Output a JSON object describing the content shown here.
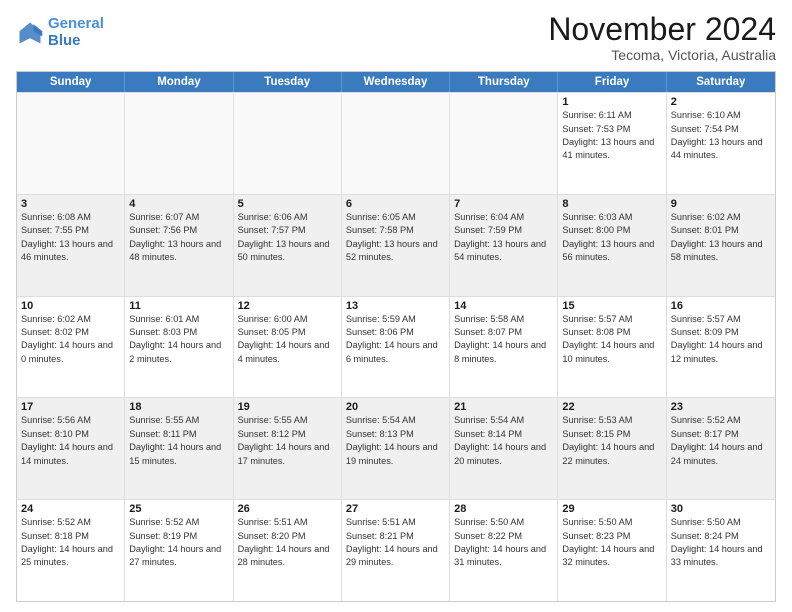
{
  "header": {
    "logo_line1": "General",
    "logo_line2": "Blue",
    "title": "November 2024",
    "subtitle": "Tecoma, Victoria, Australia"
  },
  "calendar": {
    "weekdays": [
      "Sunday",
      "Monday",
      "Tuesday",
      "Wednesday",
      "Thursday",
      "Friday",
      "Saturday"
    ],
    "weeks": [
      [
        {
          "day": "",
          "empty": true
        },
        {
          "day": "",
          "empty": true
        },
        {
          "day": "",
          "empty": true
        },
        {
          "day": "",
          "empty": true
        },
        {
          "day": "",
          "empty": true
        },
        {
          "day": "1",
          "sunrise": "6:11 AM",
          "sunset": "7:53 PM",
          "daylight": "13 hours and 41 minutes."
        },
        {
          "day": "2",
          "sunrise": "6:10 AM",
          "sunset": "7:54 PM",
          "daylight": "13 hours and 44 minutes."
        }
      ],
      [
        {
          "day": "3",
          "sunrise": "6:08 AM",
          "sunset": "7:55 PM",
          "daylight": "13 hours and 46 minutes."
        },
        {
          "day": "4",
          "sunrise": "6:07 AM",
          "sunset": "7:56 PM",
          "daylight": "13 hours and 48 minutes."
        },
        {
          "day": "5",
          "sunrise": "6:06 AM",
          "sunset": "7:57 PM",
          "daylight": "13 hours and 50 minutes."
        },
        {
          "day": "6",
          "sunrise": "6:05 AM",
          "sunset": "7:58 PM",
          "daylight": "13 hours and 52 minutes."
        },
        {
          "day": "7",
          "sunrise": "6:04 AM",
          "sunset": "7:59 PM",
          "daylight": "13 hours and 54 minutes."
        },
        {
          "day": "8",
          "sunrise": "6:03 AM",
          "sunset": "8:00 PM",
          "daylight": "13 hours and 56 minutes."
        },
        {
          "day": "9",
          "sunrise": "6:02 AM",
          "sunset": "8:01 PM",
          "daylight": "13 hours and 58 minutes."
        }
      ],
      [
        {
          "day": "10",
          "sunrise": "6:02 AM",
          "sunset": "8:02 PM",
          "daylight": "14 hours and 0 minutes."
        },
        {
          "day": "11",
          "sunrise": "6:01 AM",
          "sunset": "8:03 PM",
          "daylight": "14 hours and 2 minutes."
        },
        {
          "day": "12",
          "sunrise": "6:00 AM",
          "sunset": "8:05 PM",
          "daylight": "14 hours and 4 minutes."
        },
        {
          "day": "13",
          "sunrise": "5:59 AM",
          "sunset": "8:06 PM",
          "daylight": "14 hours and 6 minutes."
        },
        {
          "day": "14",
          "sunrise": "5:58 AM",
          "sunset": "8:07 PM",
          "daylight": "14 hours and 8 minutes."
        },
        {
          "day": "15",
          "sunrise": "5:57 AM",
          "sunset": "8:08 PM",
          "daylight": "14 hours and 10 minutes."
        },
        {
          "day": "16",
          "sunrise": "5:57 AM",
          "sunset": "8:09 PM",
          "daylight": "14 hours and 12 minutes."
        }
      ],
      [
        {
          "day": "17",
          "sunrise": "5:56 AM",
          "sunset": "8:10 PM",
          "daylight": "14 hours and 14 minutes."
        },
        {
          "day": "18",
          "sunrise": "5:55 AM",
          "sunset": "8:11 PM",
          "daylight": "14 hours and 15 minutes."
        },
        {
          "day": "19",
          "sunrise": "5:55 AM",
          "sunset": "8:12 PM",
          "daylight": "14 hours and 17 minutes."
        },
        {
          "day": "20",
          "sunrise": "5:54 AM",
          "sunset": "8:13 PM",
          "daylight": "14 hours and 19 minutes."
        },
        {
          "day": "21",
          "sunrise": "5:54 AM",
          "sunset": "8:14 PM",
          "daylight": "14 hours and 20 minutes."
        },
        {
          "day": "22",
          "sunrise": "5:53 AM",
          "sunset": "8:15 PM",
          "daylight": "14 hours and 22 minutes."
        },
        {
          "day": "23",
          "sunrise": "5:52 AM",
          "sunset": "8:17 PM",
          "daylight": "14 hours and 24 minutes."
        }
      ],
      [
        {
          "day": "24",
          "sunrise": "5:52 AM",
          "sunset": "8:18 PM",
          "daylight": "14 hours and 25 minutes."
        },
        {
          "day": "25",
          "sunrise": "5:52 AM",
          "sunset": "8:19 PM",
          "daylight": "14 hours and 27 minutes."
        },
        {
          "day": "26",
          "sunrise": "5:51 AM",
          "sunset": "8:20 PM",
          "daylight": "14 hours and 28 minutes."
        },
        {
          "day": "27",
          "sunrise": "5:51 AM",
          "sunset": "8:21 PM",
          "daylight": "14 hours and 29 minutes."
        },
        {
          "day": "28",
          "sunrise": "5:50 AM",
          "sunset": "8:22 PM",
          "daylight": "14 hours and 31 minutes."
        },
        {
          "day": "29",
          "sunrise": "5:50 AM",
          "sunset": "8:23 PM",
          "daylight": "14 hours and 32 minutes."
        },
        {
          "day": "30",
          "sunrise": "5:50 AM",
          "sunset": "8:24 PM",
          "daylight": "14 hours and 33 minutes."
        }
      ]
    ]
  },
  "labels": {
    "sunrise": "Sunrise:",
    "sunset": "Sunset:",
    "daylight": "Daylight:"
  }
}
